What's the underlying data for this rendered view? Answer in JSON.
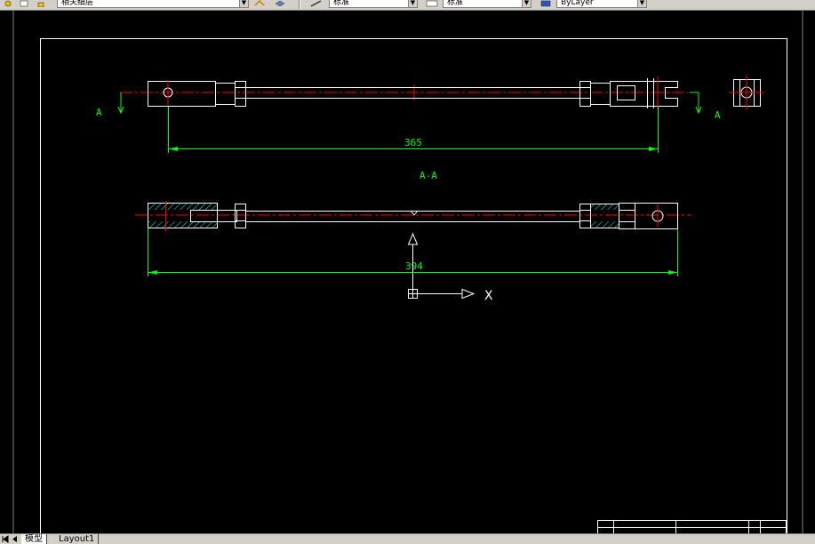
{
  "toolbar": {
    "layer_combo": "相关细层",
    "linetype_combo": "标准",
    "lineweight_combo": "标准",
    "color_combo": "ByLayer"
  },
  "drawing": {
    "dim_top": "365",
    "dim_bottom": "394",
    "section_label": "A-A",
    "section_marker_left": "A",
    "section_marker_right": "A",
    "ucs_x": "X"
  },
  "tabs": [
    {
      "label": "模型"
    },
    {
      "label": "Layout1"
    }
  ],
  "colors": {
    "background": "#000000",
    "geometry": "#ffffff",
    "dimension": "#00ff00",
    "centerline": "#ff0000",
    "hatch": "#00ffff"
  }
}
